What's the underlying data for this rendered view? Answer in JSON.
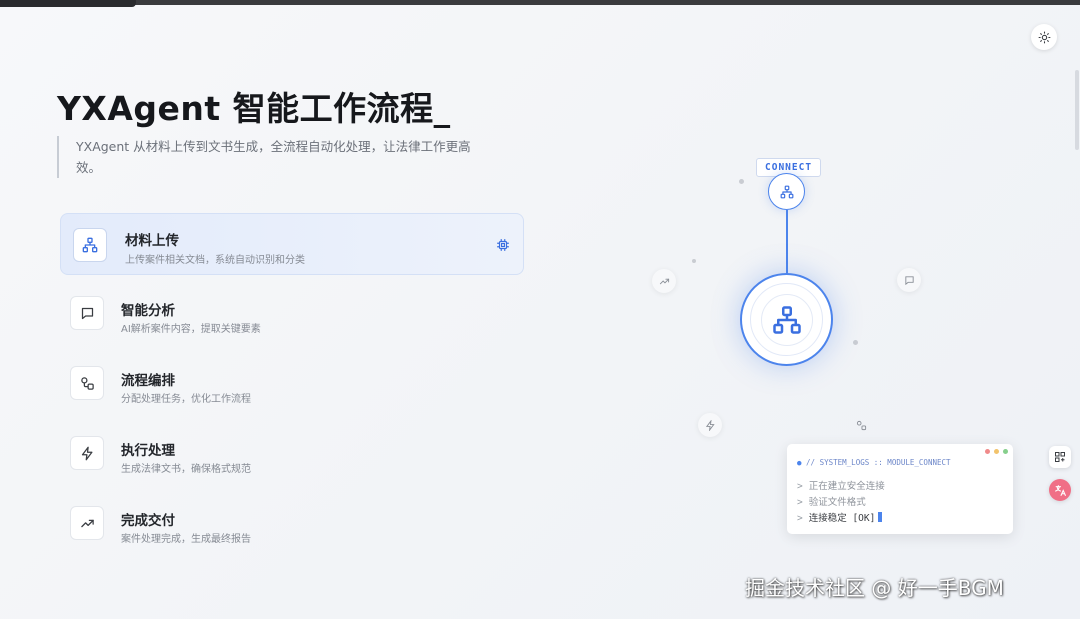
{
  "page": {
    "title": "YXAgent 智能工作流程",
    "title_cursor": "_",
    "subtitle": "YXAgent 从材料上传到文书生成，全流程自动化处理，让法律工作更高效。"
  },
  "steps": [
    {
      "title": "材料上传",
      "desc": "上传案件相关文档，系统自动识别和分类",
      "icon": "sitemap-icon",
      "active": true
    },
    {
      "title": "智能分析",
      "desc": "AI解析案件内容，提取关键要素",
      "icon": "chat-icon",
      "active": false
    },
    {
      "title": "流程编排",
      "desc": "分配处理任务，优化工作流程",
      "icon": "workflow-icon",
      "active": false
    },
    {
      "title": "执行处理",
      "desc": "生成法律文书，确保格式规范",
      "icon": "lightning-icon",
      "active": false
    },
    {
      "title": "完成交付",
      "desc": "案件处理完成，生成最终报告",
      "icon": "trending-up-icon",
      "active": false
    }
  ],
  "diagram": {
    "connect_label": "CONNECT",
    "accent_color": "#4c84ec"
  },
  "log": {
    "header": "// SYSTEM_LOGS :: MODULE_CONNECT",
    "lines": [
      {
        "text": "正在建立安全连接"
      },
      {
        "text": "验证文件格式"
      },
      {
        "text": "连接稳定 [OK]"
      }
    ],
    "prompt": ">"
  },
  "watermark": "掘金技术社区 @ 好一手BGM",
  "colors": {
    "accent": "#4c84ec",
    "active_step_bg": "#e3ebfb",
    "translate_button": "#f06f86"
  }
}
